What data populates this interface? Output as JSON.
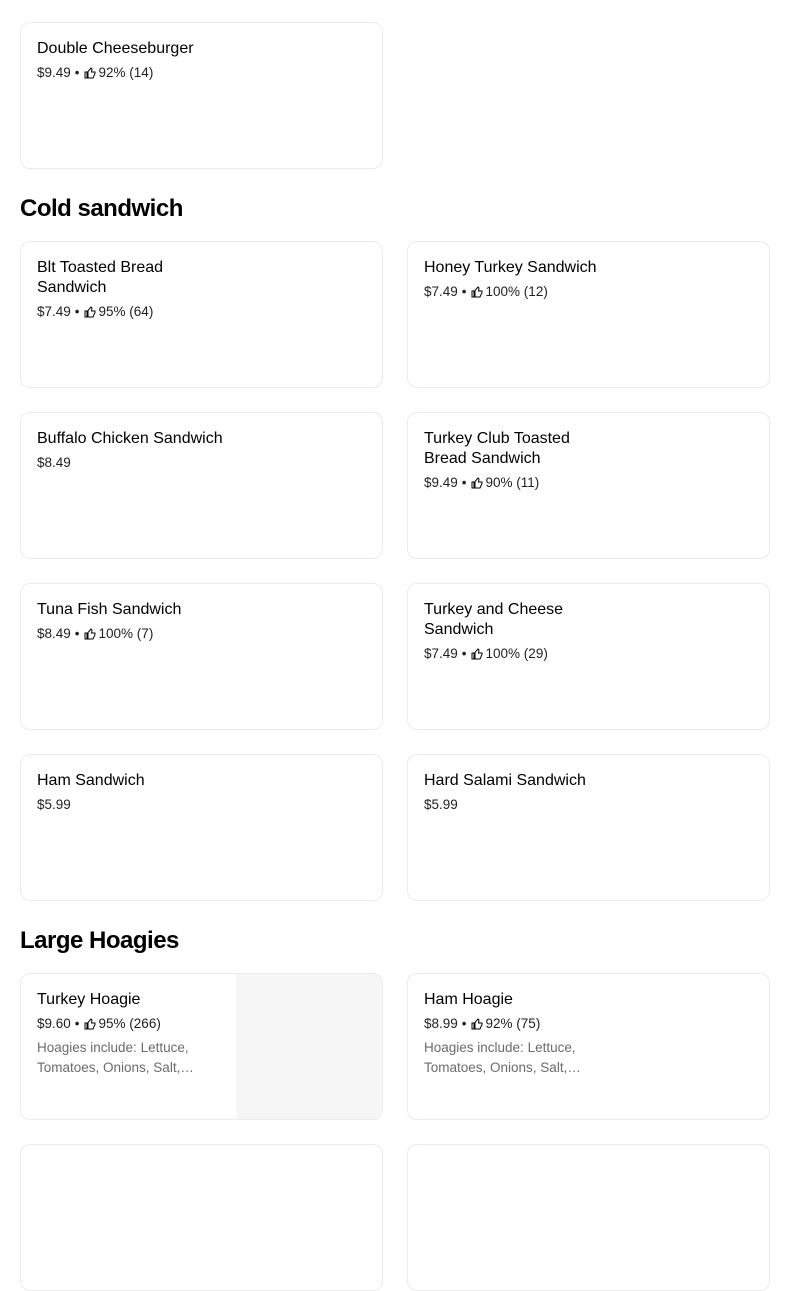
{
  "items": [
    {
      "name": "Double Cheeseburger",
      "price": "$9.49",
      "rating": "92% (14)"
    },
    {
      "name": "Blt Toasted Bread Sandwich",
      "price": "$7.49",
      "rating": "95% (64)"
    },
    {
      "name": "Honey Turkey Sandwich",
      "price": "$7.49",
      "rating": "100% (12)"
    },
    {
      "name": "Buffalo Chicken Sandwich",
      "price": "$8.49",
      "rating": ""
    },
    {
      "name": "Turkey Club Toasted Bread Sandwich",
      "price": "$9.49",
      "rating": "90% (11)"
    },
    {
      "name": "Tuna Fish Sandwich",
      "price": "$8.49",
      "rating": "100% (7)"
    },
    {
      "name": "Turkey and Cheese Sandwich",
      "price": "$7.49",
      "rating": "100% (29)"
    },
    {
      "name": "Ham Sandwich",
      "price": "$5.99",
      "rating": ""
    },
    {
      "name": "Hard Salami Sandwich",
      "price": "$5.99",
      "rating": ""
    },
    {
      "name": "Turkey Hoagie",
      "price": "$9.60",
      "rating": "95% (266)",
      "description": "Hoagies include: Lettuce, Tomatoes, Onions, Salt,…"
    },
    {
      "name": "Ham Hoagie",
      "price": "$8.99",
      "rating": "92% (75)",
      "description": "Hoagies include: Lettuce, Tomatoes, Onions, Salt,…"
    }
  ],
  "sections": {
    "cold_sandwich": "Cold sandwich",
    "large_hoagies": "Large Hoagies"
  },
  "icons": {
    "rating": "thumbs-up-icon"
  }
}
